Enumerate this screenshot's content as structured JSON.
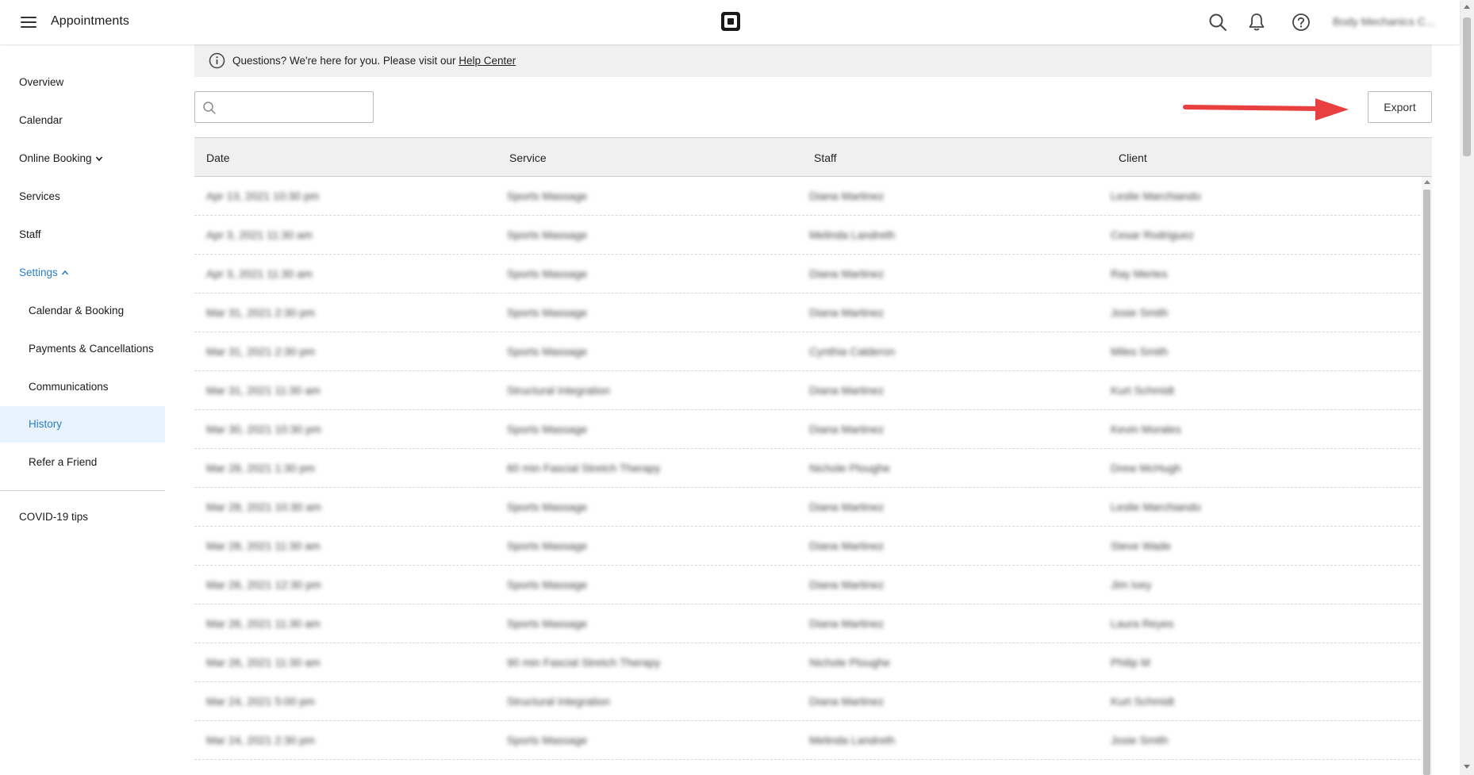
{
  "app": {
    "title": "Appointments",
    "user_name": "Body Mechanics C..."
  },
  "colors": {
    "accent": "#2a7fc4",
    "active_bg": "#e8f3fd",
    "arrow": "#e8403f"
  },
  "header_icons": [
    "menu-icon",
    "square-logo-icon",
    "search-icon",
    "bell-icon",
    "help-icon"
  ],
  "sidebar": {
    "items": [
      {
        "label": "Overview",
        "name": "sidebar-item-overview"
      },
      {
        "label": "Calendar",
        "name": "sidebar-item-calendar"
      },
      {
        "label": "Online Booking",
        "name": "sidebar-item-online-booking"
      },
      {
        "label": "Services",
        "name": "sidebar-item-services"
      },
      {
        "label": "Staff",
        "name": "sidebar-item-staff"
      },
      {
        "label": "Settings",
        "name": "sidebar-item-settings"
      },
      {
        "label": "Calendar & Booking",
        "name": "sidebar-item-calendar-booking"
      },
      {
        "label": "Payments & Cancellations",
        "name": "sidebar-item-payments-cancellations"
      },
      {
        "label": "Communications",
        "name": "sidebar-item-communications"
      },
      {
        "label": "History",
        "name": "sidebar-item-history"
      },
      {
        "label": "Refer a Friend",
        "name": "sidebar-item-refer-a-friend"
      },
      {
        "label": "COVID-19 tips",
        "name": "sidebar-item-covid-tips"
      }
    ]
  },
  "help_banner": {
    "text": "Questions? We're here for you. Please visit our ",
    "link": "Help Center"
  },
  "search": {
    "value": "",
    "placeholder": ""
  },
  "toolbar": {
    "export_label": "Export"
  },
  "table": {
    "headers": [
      "Date",
      "Service",
      "Staff",
      "Client"
    ],
    "rows": [
      [
        "Apr 13, 2021 10:30 pm",
        "Sports Massage",
        "Diana Martinez",
        "Leslie Marchiando"
      ],
      [
        "Apr 3, 2021 11:30 am",
        "Sports Massage",
        "Melinda Landreth",
        "Cesar Rodriguez"
      ],
      [
        "Apr 3, 2021 11:30 am",
        "Sports Massage",
        "Diana Martinez",
        "Ray Mertes"
      ],
      [
        "Mar 31, 2021 2:30 pm",
        "Sports Massage",
        "Diana Martinez",
        "Josie Smith"
      ],
      [
        "Mar 31, 2021 2:30 pm",
        "Sports Massage",
        "Cynthia Calderon",
        "Miles Smith"
      ],
      [
        "Mar 31, 2021 11:30 am",
        "Structural Integration",
        "Diana Martinez",
        "Kurt Schmidt"
      ],
      [
        "Mar 30, 2021 10:30 pm",
        "Sports Massage",
        "Diana Martinez",
        "Kevin Morales"
      ],
      [
        "Mar 28, 2021 1:30 pm",
        "60 min Fascial Stretch Therapy",
        "Nichole Ploughe",
        "Drew McHugh"
      ],
      [
        "Mar 28, 2021 10:30 am",
        "Sports Massage",
        "Diana Martinez",
        "Leslie Marchiando"
      ],
      [
        "Mar 28, 2021 11:30 am",
        "Sports Massage",
        "Diana Martinez",
        "Steve Wade"
      ],
      [
        "Mar 26, 2021 12:30 pm",
        "Sports Massage",
        "Diana Martinez",
        "Jim Ivey"
      ],
      [
        "Mar 26, 2021 11:30 am",
        "Sports Massage",
        "Diana Martinez",
        "Laura Reyes"
      ],
      [
        "Mar 26, 2021 11:30 am",
        "90 min Fascial Stretch Therapy",
        "Nichole Ploughe",
        "Philip M"
      ],
      [
        "Mar 24, 2021 5:00 pm",
        "Structural Integration",
        "Diana Martinez",
        "Kurt Schmidt"
      ],
      [
        "Mar 24, 2021 2:30 pm",
        "Sports Massage",
        "Melinda Landreth",
        "Josie Smith"
      ]
    ]
  }
}
